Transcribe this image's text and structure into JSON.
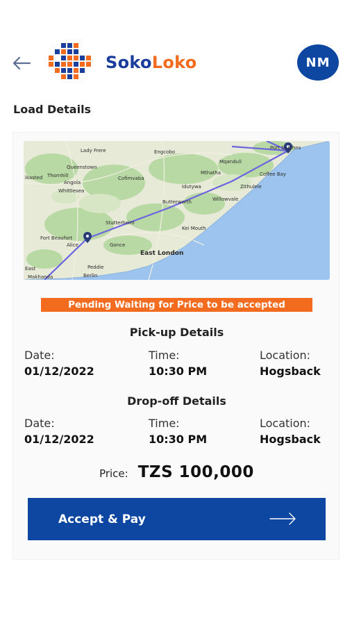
{
  "header": {
    "brand_part1": "Soko",
    "brand_part2": "Loko",
    "avatar_initials": "NM"
  },
  "page": {
    "title": "Load Details"
  },
  "map": {
    "place_labels": [
      "Lady Frere",
      "Engcobo",
      "Queenstown",
      "Mqanduli",
      "Port St Johns",
      "Coffee Bay",
      "Thornhill",
      "Cofimvaba",
      "Mthatha",
      "Angola",
      "Whittlesea",
      "Idutywa",
      "Zithulele",
      "Willowvale",
      "Butterworth",
      "Stutterheim",
      "Kei Mouth",
      "Fort Beaufort",
      "Alice",
      "Gonce",
      "East London",
      "Peddie",
      "Makhanda",
      "East",
      "Berlin",
      "ikasted"
    ]
  },
  "status": {
    "text": "Pending Waiting for Price to be accepted"
  },
  "pickup": {
    "heading": "Pick-up Details",
    "date_label": "Date:",
    "date_value": "01/12/2022",
    "time_label": "Time:",
    "time_value": "10:30 PM",
    "location_label": "Location:",
    "location_value": "Hogsback"
  },
  "dropoff": {
    "heading": "Drop-off Details",
    "date_label": "Date:",
    "date_value": "01/12/2022",
    "time_label": "Time:",
    "time_value": "10:30 PM",
    "location_label": "Location:",
    "location_value": "Hogsback"
  },
  "price": {
    "label": "Price:",
    "value": "TZS 100,000"
  },
  "actions": {
    "accept_label": "Accept & Pay"
  },
  "colors": {
    "brand_blue": "#0d47a1",
    "brand_orange": "#f26b1f",
    "route_line": "#6b63e0"
  },
  "icons": {
    "back": "arrow-left-icon",
    "accept": "arrow-right-icon",
    "map_pin": "map-pin-icon"
  }
}
